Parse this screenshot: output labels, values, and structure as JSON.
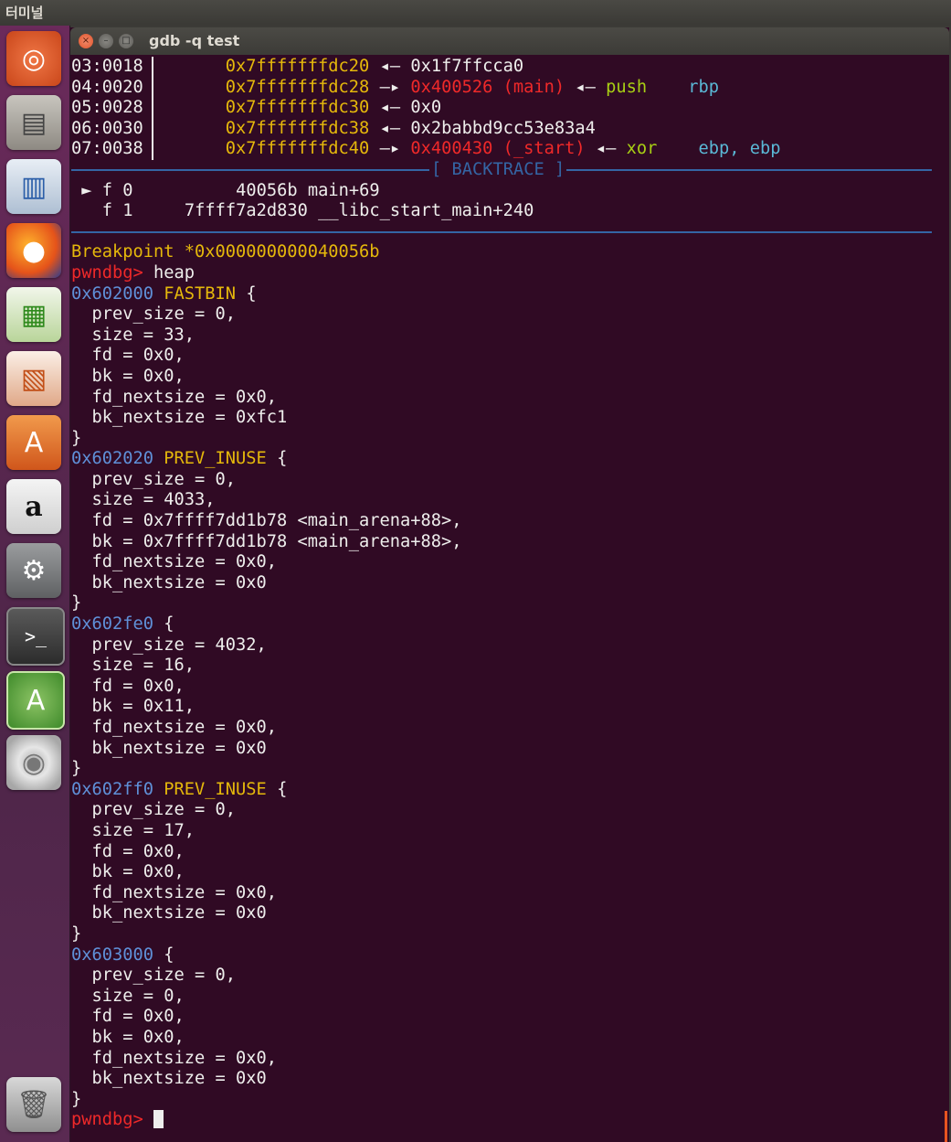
{
  "panel": {
    "title": "터미널"
  },
  "launcher": {
    "items": [
      {
        "name": "ubuntu-dash",
        "glyph": "◎"
      },
      {
        "name": "files",
        "glyph": "▤"
      },
      {
        "name": "writer",
        "glyph": "▥"
      },
      {
        "name": "firefox",
        "glyph": "●"
      },
      {
        "name": "calc",
        "glyph": "▦"
      },
      {
        "name": "impress",
        "glyph": "▧"
      },
      {
        "name": "software-center",
        "glyph": "A"
      },
      {
        "name": "amazon",
        "glyph": "a"
      },
      {
        "name": "system-settings",
        "glyph": "⚙"
      },
      {
        "name": "terminal",
        "glyph": ">_"
      },
      {
        "name": "software-updater",
        "glyph": "A"
      },
      {
        "name": "dvd",
        "glyph": "◉"
      },
      {
        "name": "trash",
        "glyph": "🗑"
      }
    ]
  },
  "window": {
    "title": "gdb -q test",
    "close_glyph": "×",
    "min_glyph": "–",
    "max_glyph": "□"
  },
  "stack": [
    {
      "off": "03:0018",
      "addr": "0x7fffffffdc20",
      "arrow": "◂—",
      "val": "0x1f7ffcca0",
      "sym": "",
      "arrow2": "",
      "ins": "",
      "ops": ""
    },
    {
      "off": "04:0020",
      "addr": "0x7fffffffdc28",
      "arrow": "—▸",
      "val": "0x400526 (main)",
      "sym": "",
      "arrow2": "◂—",
      "ins": "push",
      "ops": "rbp"
    },
    {
      "off": "05:0028",
      "addr": "0x7fffffffdc30",
      "arrow": "◂—",
      "val": "0x0",
      "sym": "",
      "arrow2": "",
      "ins": "",
      "ops": ""
    },
    {
      "off": "06:0030",
      "addr": "0x7fffffffdc38",
      "arrow": "◂—",
      "val": "0x2babbd9cc53e83a4",
      "sym": "",
      "arrow2": "",
      "ins": "",
      "ops": ""
    },
    {
      "off": "07:0038",
      "addr": "0x7fffffffdc40",
      "arrow": "—▸",
      "val": "0x400430 (_start)",
      "sym": "",
      "arrow2": "◂—",
      "ins": "xor",
      "ops": "ebp, ebp"
    }
  ],
  "backtrace_label": "[ BACKTRACE ]",
  "backtrace": [
    {
      "mark": "►",
      "frame": "f 0",
      "addr": "40056b",
      "sym": "main+69"
    },
    {
      "mark": "",
      "frame": "f 1",
      "addr": "7ffff7a2d830",
      "sym": "__libc_start_main+240"
    }
  ],
  "breakpoint": "Breakpoint *0x000000000040056b",
  "prompt": "pwndbg>",
  "command": "heap",
  "chunks": [
    {
      "addr": "0x602000",
      "flag": "FASTBIN",
      "fields": [
        "prev_size = 0,",
        "size = 33,",
        "fd = 0x0,",
        "bk = 0x0,",
        "fd_nextsize = 0x0,",
        "bk_nextsize = 0xfc1"
      ]
    },
    {
      "addr": "0x602020",
      "flag": "PREV_INUSE",
      "fields": [
        "prev_size = 0,",
        "size = 4033,",
        "fd = 0x7ffff7dd1b78 <main_arena+88>,",
        "bk = 0x7ffff7dd1b78 <main_arena+88>,",
        "fd_nextsize = 0x0,",
        "bk_nextsize = 0x0"
      ]
    },
    {
      "addr": "0x602fe0",
      "flag": "",
      "fields": [
        "prev_size = 4032,",
        "size = 16,",
        "fd = 0x0,",
        "bk = 0x11,",
        "fd_nextsize = 0x0,",
        "bk_nextsize = 0x0"
      ]
    },
    {
      "addr": "0x602ff0",
      "flag": "PREV_INUSE",
      "fields": [
        "prev_size = 0,",
        "size = 17,",
        "fd = 0x0,",
        "bk = 0x0,",
        "fd_nextsize = 0x0,",
        "bk_nextsize = 0x0"
      ]
    },
    {
      "addr": "0x603000",
      "flag": "",
      "fields": [
        "prev_size = 0,",
        "size = 0,",
        "fd = 0x0,",
        "bk = 0x0,",
        "fd_nextsize = 0x0,",
        "bk_nextsize = 0x0"
      ]
    }
  ],
  "brace_open": "{",
  "brace_close": "}",
  "colors": {
    "background": "#300a24",
    "address": "#3465a4",
    "flag": "#e5b80b",
    "prompt": "#ef2929",
    "accent": "#e95420"
  }
}
